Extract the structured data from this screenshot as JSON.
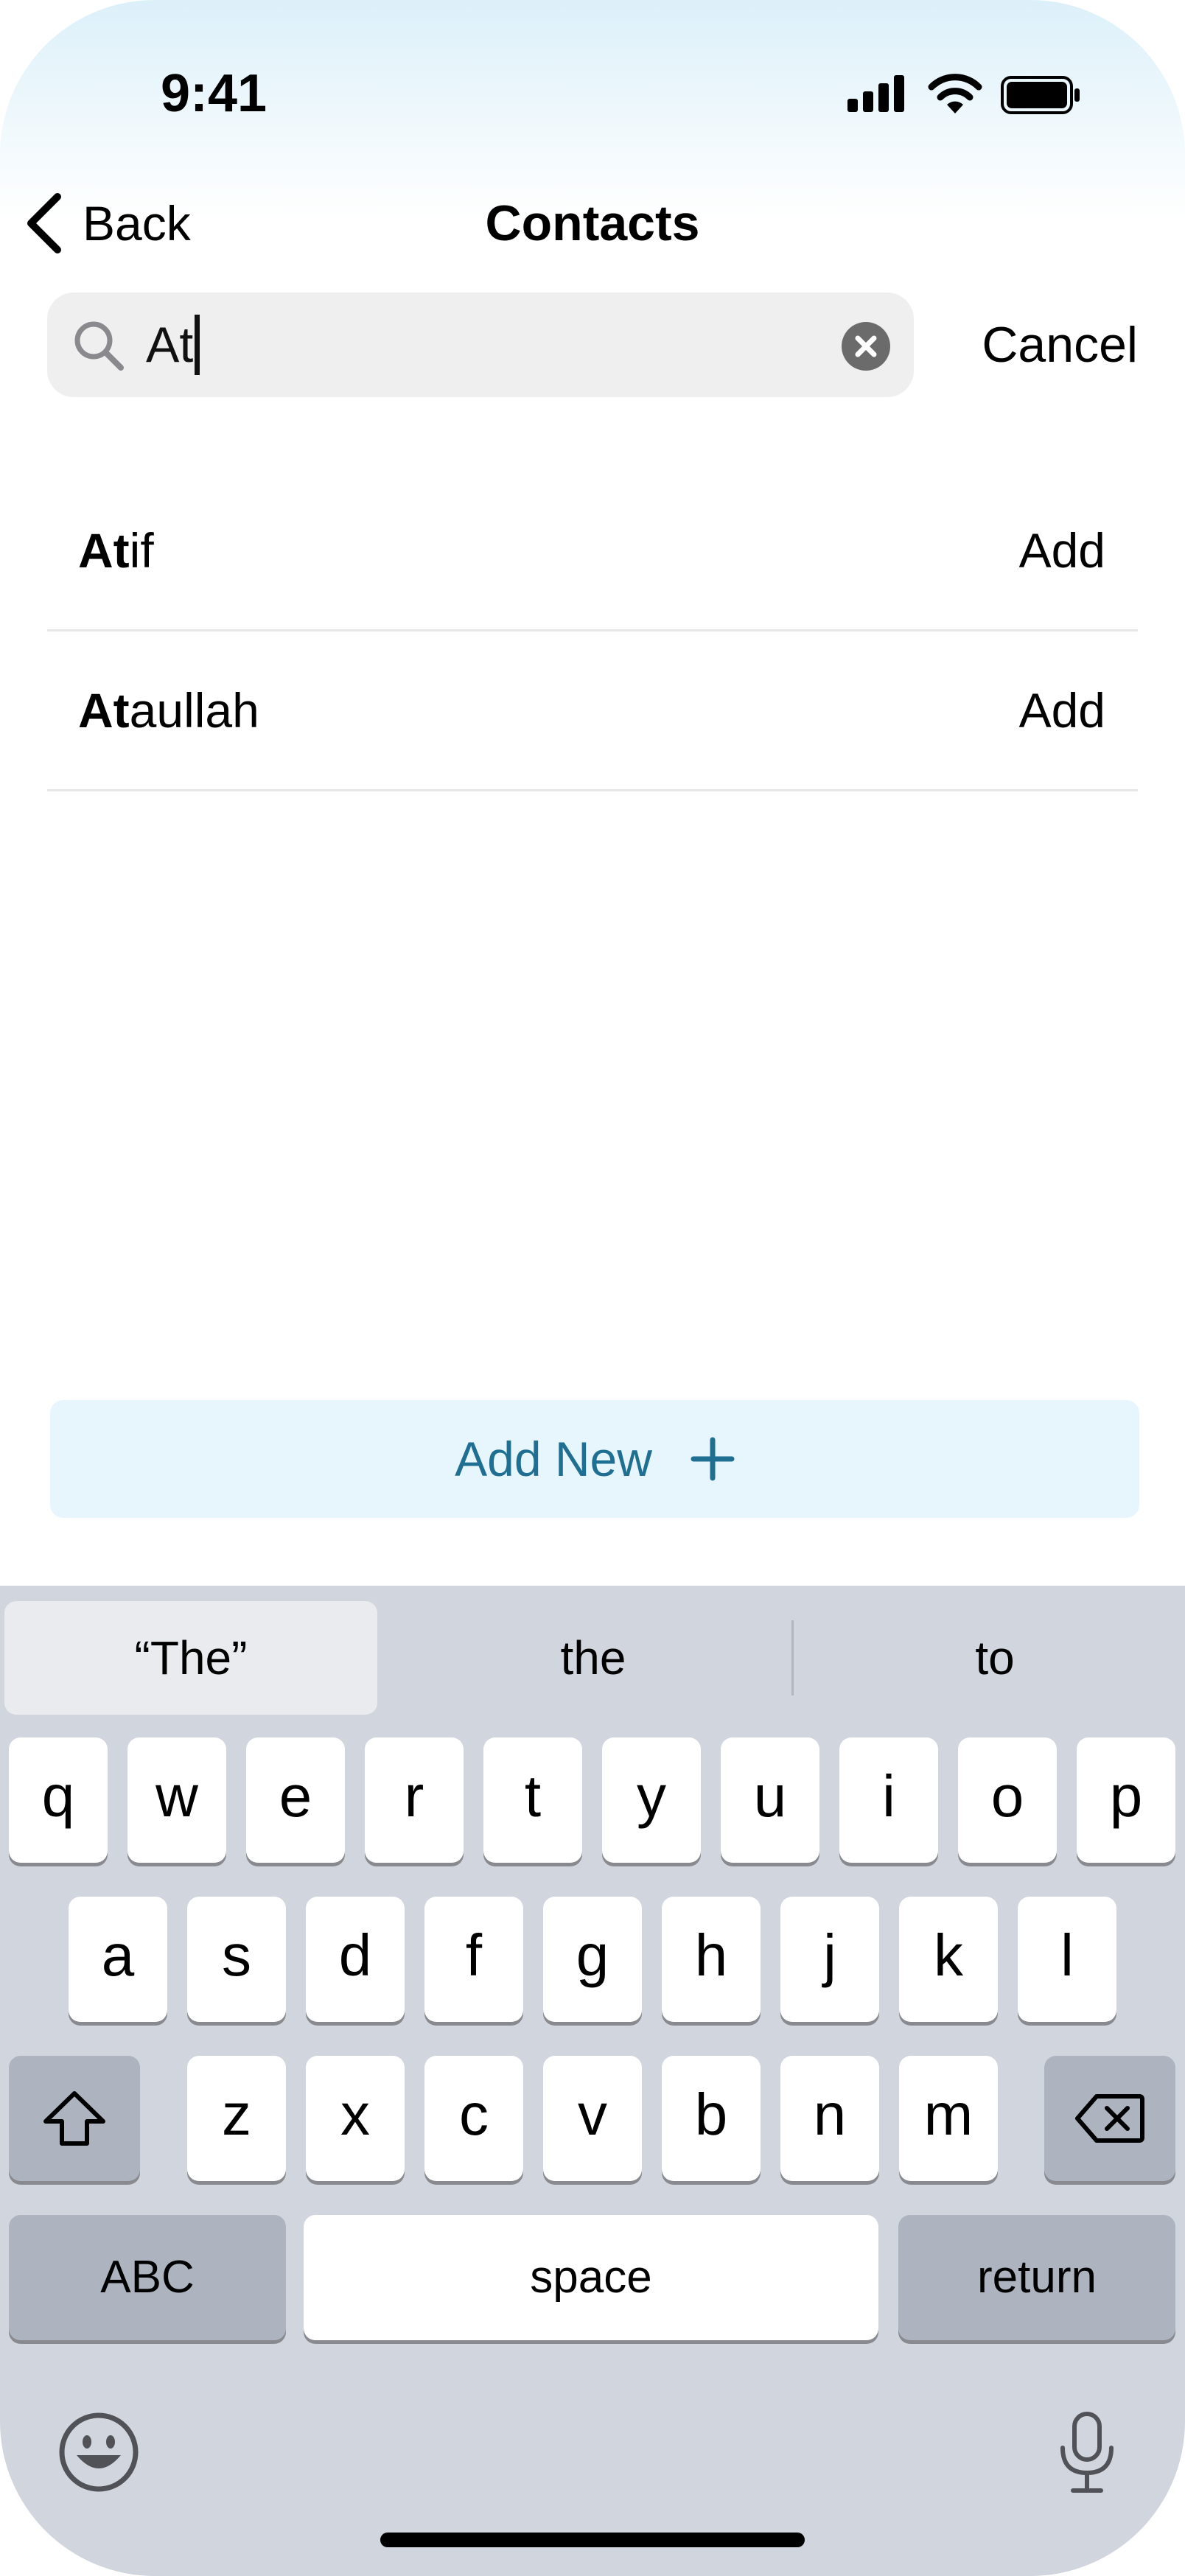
{
  "status_bar": {
    "time": "9:41"
  },
  "nav": {
    "back_label": "Back",
    "title": "Contacts"
  },
  "search": {
    "query": "At",
    "cancel_label": "Cancel"
  },
  "results": [
    {
      "match": "At",
      "rest": "if",
      "action": "Add"
    },
    {
      "match": "At",
      "rest": "aullah",
      "action": "Add"
    }
  ],
  "add_new": {
    "label": "Add New",
    "icon": "+"
  },
  "keyboard": {
    "suggestions": [
      "“The”",
      "the",
      "to"
    ],
    "row1": [
      "q",
      "w",
      "e",
      "r",
      "t",
      "y",
      "u",
      "i",
      "o",
      "p"
    ],
    "row2": [
      "a",
      "s",
      "d",
      "f",
      "g",
      "h",
      "j",
      "k",
      "l"
    ],
    "row3": [
      "z",
      "x",
      "c",
      "v",
      "b",
      "n",
      "m"
    ],
    "abc_label": "ABC",
    "space_label": "space",
    "return_label": "return"
  },
  "colors": {
    "accent": "#1f6f92",
    "add_new_bg": "#e7f5fc",
    "keyboard_bg": "#d1d5dd"
  }
}
